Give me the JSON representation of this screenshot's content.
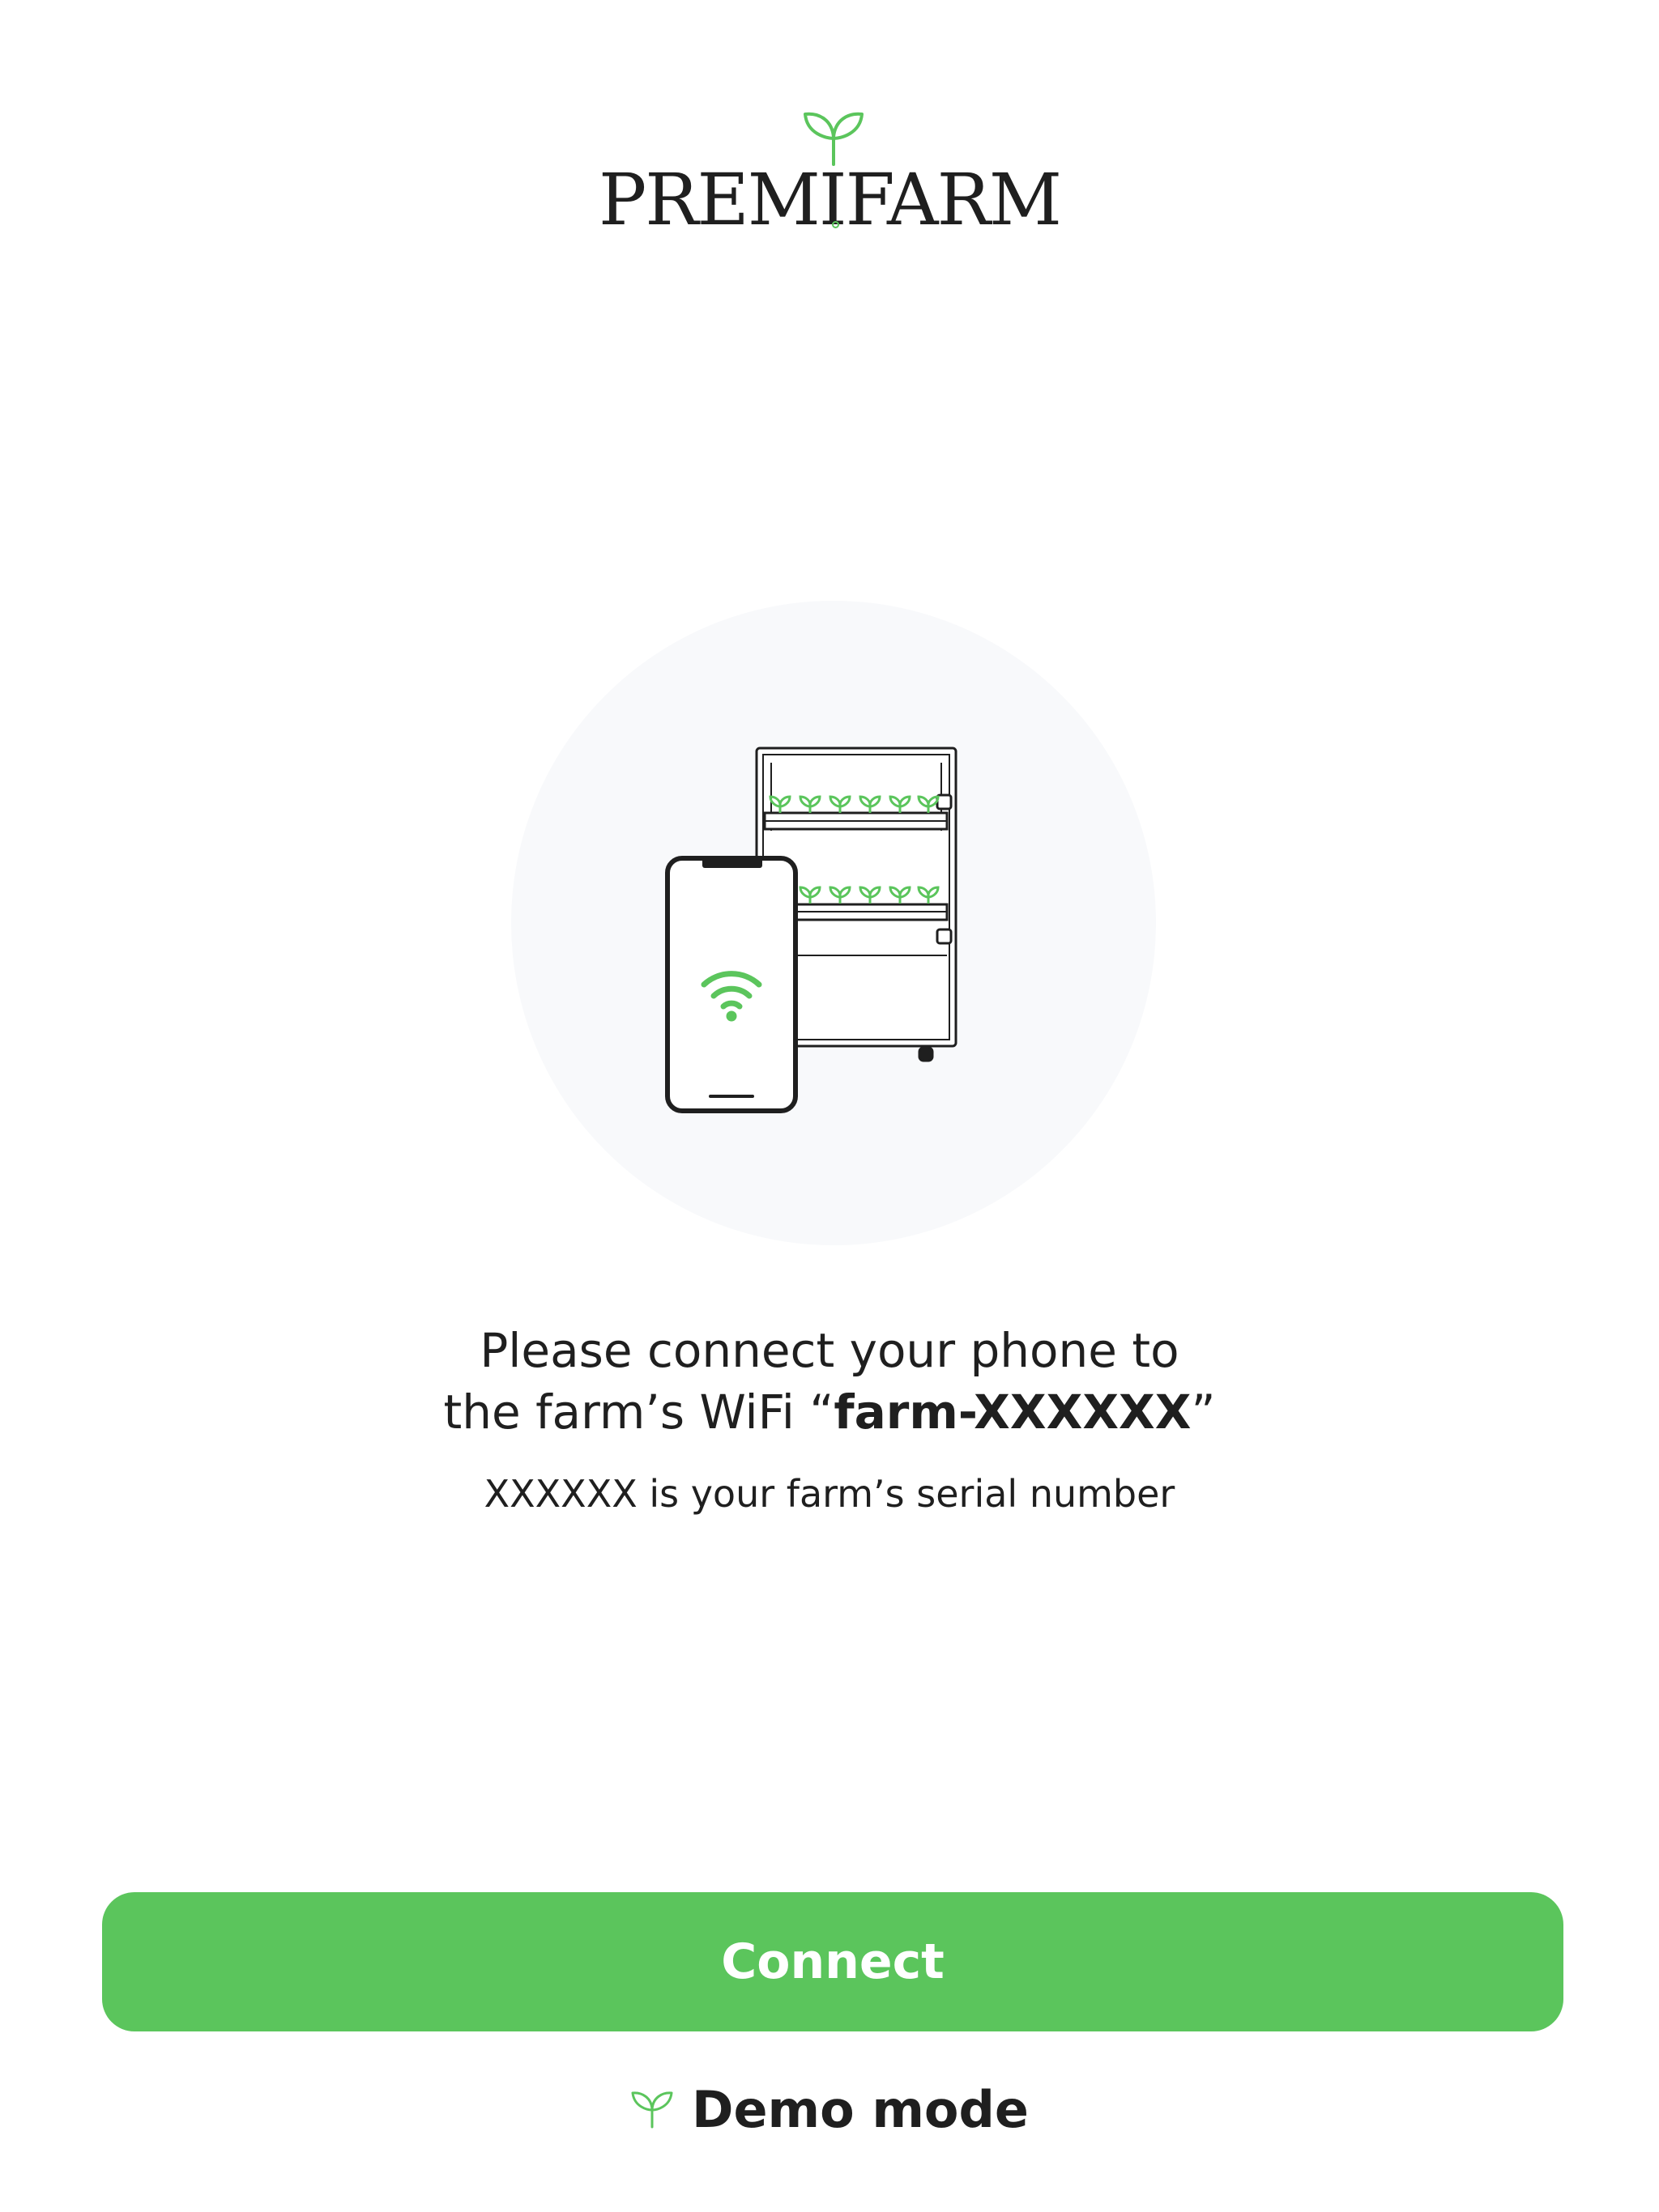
{
  "brand": {
    "name": "PREMIFARM",
    "logo_icon": "sprout-icon",
    "accent_color": "#5bc55c"
  },
  "illustration": {
    "phone_icon": "wifi-icon",
    "farm_icon": "farm-cabinet-icon"
  },
  "instructions": {
    "line1": "Please connect your phone to",
    "line2_prefix": "the farm’s WiFi “",
    "network_name": "farm-XXXXXX",
    "line2_suffix": "”",
    "hint": "XXXXXX is your farm’s serial number"
  },
  "actions": {
    "connect_label": "Connect",
    "demo_label": "Demo mode",
    "demo_icon": "sprout-icon"
  }
}
